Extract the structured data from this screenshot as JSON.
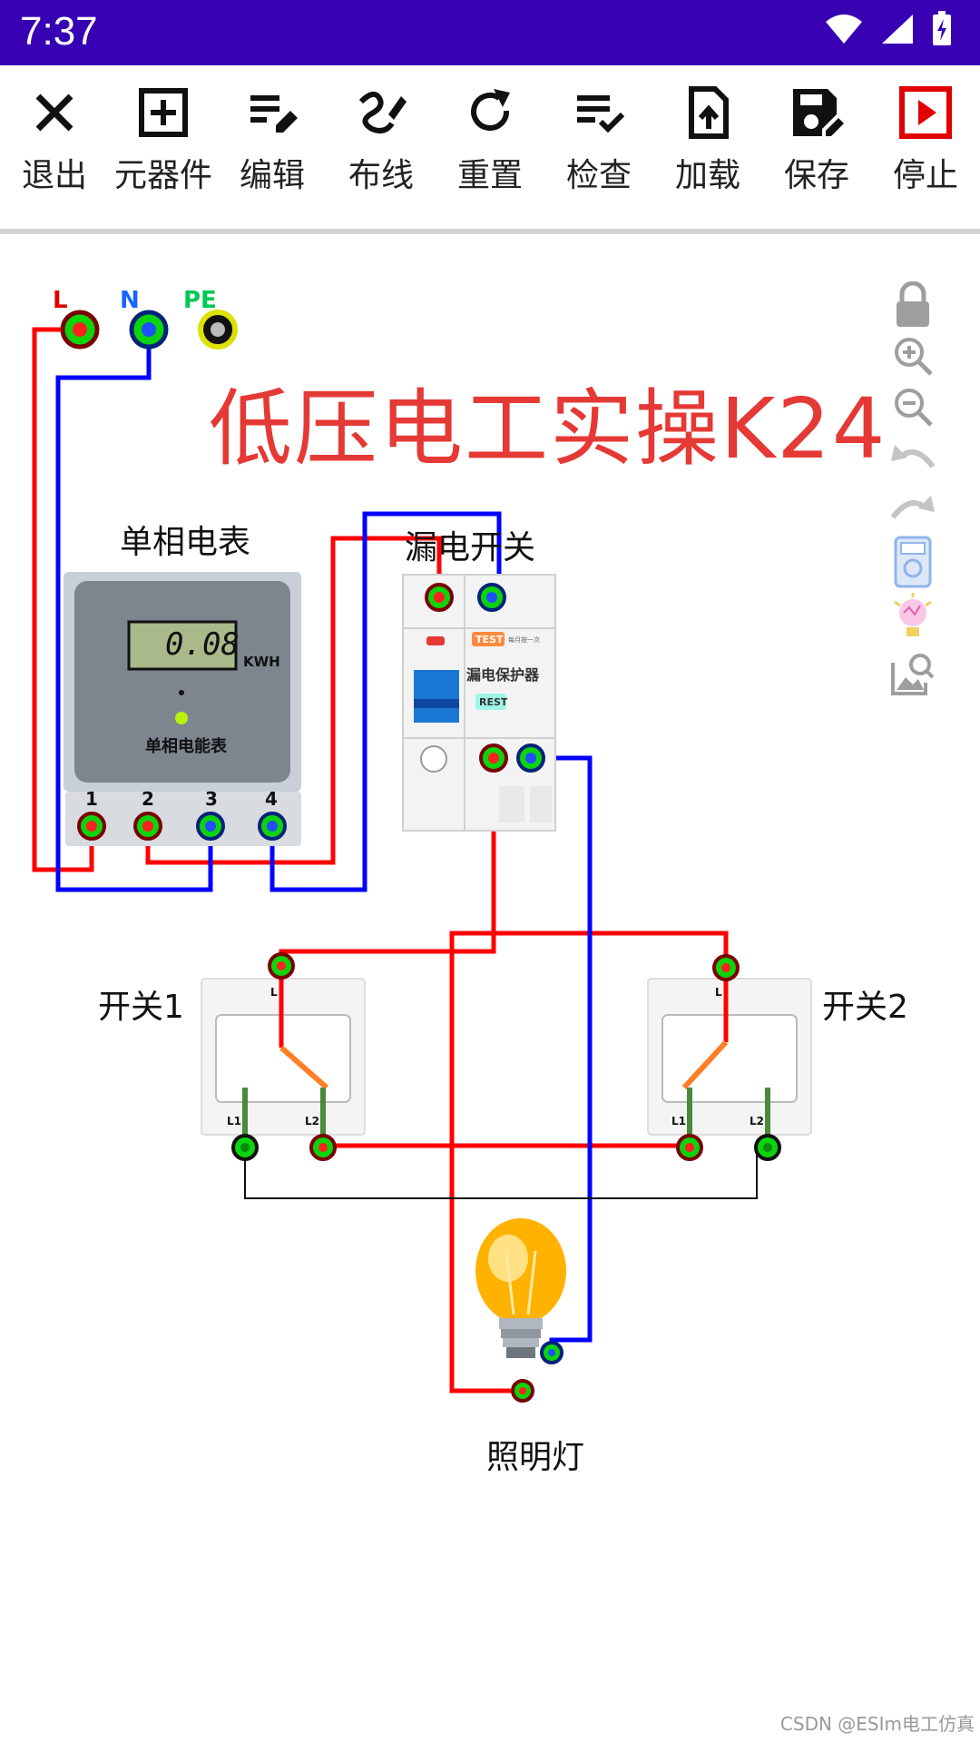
{
  "status": {
    "time": "7:37"
  },
  "toolbar": [
    {
      "label": "退出",
      "icon": "close-icon"
    },
    {
      "label": "元器件",
      "icon": "add-box-icon"
    },
    {
      "label": "编辑",
      "icon": "edit-list-icon"
    },
    {
      "label": "布线",
      "icon": "wire-draw-icon"
    },
    {
      "label": "重置",
      "icon": "refresh-icon"
    },
    {
      "label": "检查",
      "icon": "checklist-icon"
    },
    {
      "label": "加载",
      "icon": "upload-file-icon"
    },
    {
      "label": "保存",
      "icon": "save-edit-icon"
    },
    {
      "label": "停止",
      "icon": "stop-play-icon"
    }
  ],
  "canvas": {
    "title": "低压电工实操K24",
    "terminals": {
      "l": "L",
      "n": "N",
      "pe": "PE"
    },
    "meter": {
      "label": "单相电表",
      "reading": "0.08",
      "unit": "KWH",
      "name": "单相电能表",
      "terminals": [
        "1",
        "2",
        "3",
        "4"
      ]
    },
    "rcd": {
      "label": "漏电开关",
      "test": "TEST",
      "reset": "REST",
      "name": "漏电保护器",
      "note": "每月按一次"
    },
    "switch1": {
      "label": "开关1",
      "l": "L",
      "l1": "L1",
      "l2": "L2"
    },
    "switch2": {
      "label": "开关2",
      "l": "L",
      "l1": "L1",
      "l2": "L2"
    },
    "lamp": {
      "label": "照明灯"
    }
  },
  "colors": {
    "live": "#ff0000",
    "neutral": "#0000ff",
    "statusbar": "#3700b3",
    "title": "#e53935"
  },
  "watermark": "CSDN @ESIm电工仿真"
}
